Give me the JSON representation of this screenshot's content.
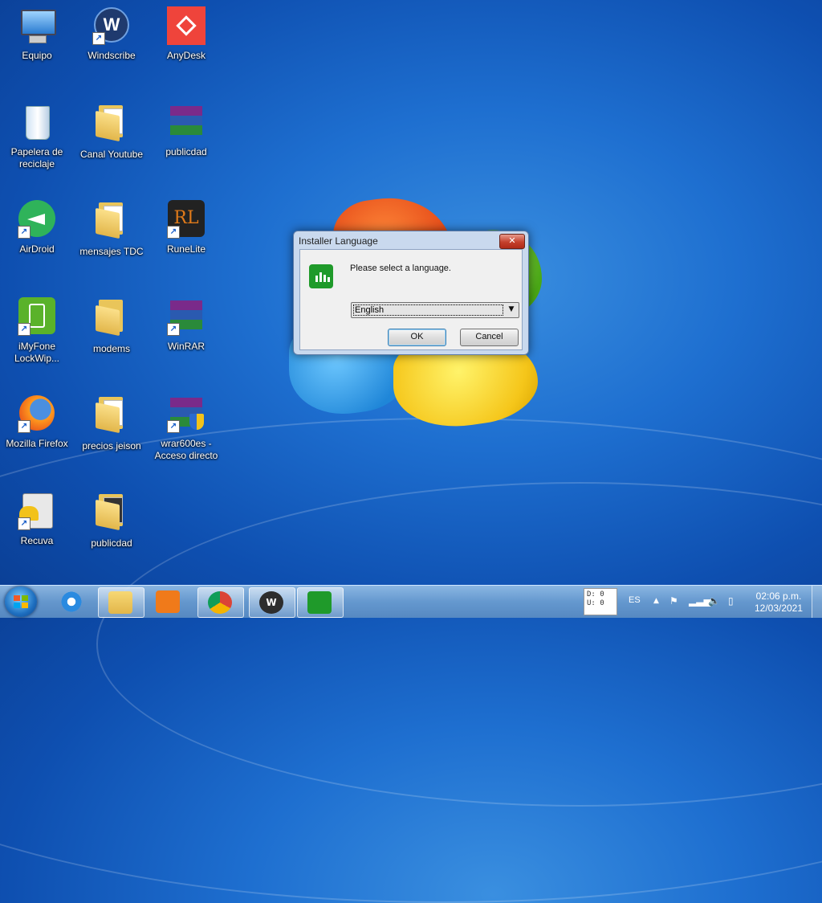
{
  "desktop": {
    "icons": [
      {
        "label": "Equipo",
        "icon": "computer-icon"
      },
      {
        "label": "Windscribe",
        "icon": "windscribe-icon"
      },
      {
        "label": "AnyDesk",
        "icon": "anydesk-icon"
      },
      {
        "label": "Papelera de reciclaje",
        "icon": "recycle-bin-icon"
      },
      {
        "label": "Canal Youtube",
        "icon": "folder-icon"
      },
      {
        "label": "publicdad",
        "icon": "winrar-archive-icon"
      },
      {
        "label": "AirDroid",
        "icon": "airdroid-icon"
      },
      {
        "label": "mensajes TDC",
        "icon": "folder-icon"
      },
      {
        "label": "RuneLite",
        "icon": "runelite-icon"
      },
      {
        "label": "iMyFone LockWip...",
        "icon": "imyfone-icon"
      },
      {
        "label": "modems",
        "icon": "folder-icon"
      },
      {
        "label": "WinRAR",
        "icon": "winrar-icon"
      },
      {
        "label": "Mozilla Firefox",
        "icon": "firefox-icon"
      },
      {
        "label": "precios jeison",
        "icon": "folder-icon"
      },
      {
        "label": "wrar600es - Acceso directo",
        "icon": "winrar-installer-icon"
      },
      {
        "label": "Recuva",
        "icon": "recuva-icon"
      },
      {
        "label": "publicdad",
        "icon": "folder-icon"
      }
    ]
  },
  "dialog": {
    "title": "Installer Language",
    "close_label": "✕",
    "message": "Please select a language.",
    "language_select": {
      "selected": "English"
    },
    "ok_label": "OK",
    "cancel_label": "Cancel",
    "icon": "installer-app-icon"
  },
  "taskbar": {
    "pinned": [
      {
        "name": "internet-explorer-icon"
      },
      {
        "name": "file-explorer-icon"
      },
      {
        "name": "media-player-icon"
      },
      {
        "name": "chrome-icon"
      },
      {
        "name": "windscribe-icon"
      },
      {
        "name": "installer-app-icon",
        "active": true
      }
    ],
    "meter": {
      "d": "D: 0",
      "u": "U: 0"
    },
    "language": "ES",
    "clock": {
      "time": "02:06 p.m.",
      "date": "12/03/2021"
    }
  },
  "colors": {
    "accent_green": "#1f9a2a",
    "taskbar": "#6aa0d4",
    "close_red": "#c4402c"
  }
}
